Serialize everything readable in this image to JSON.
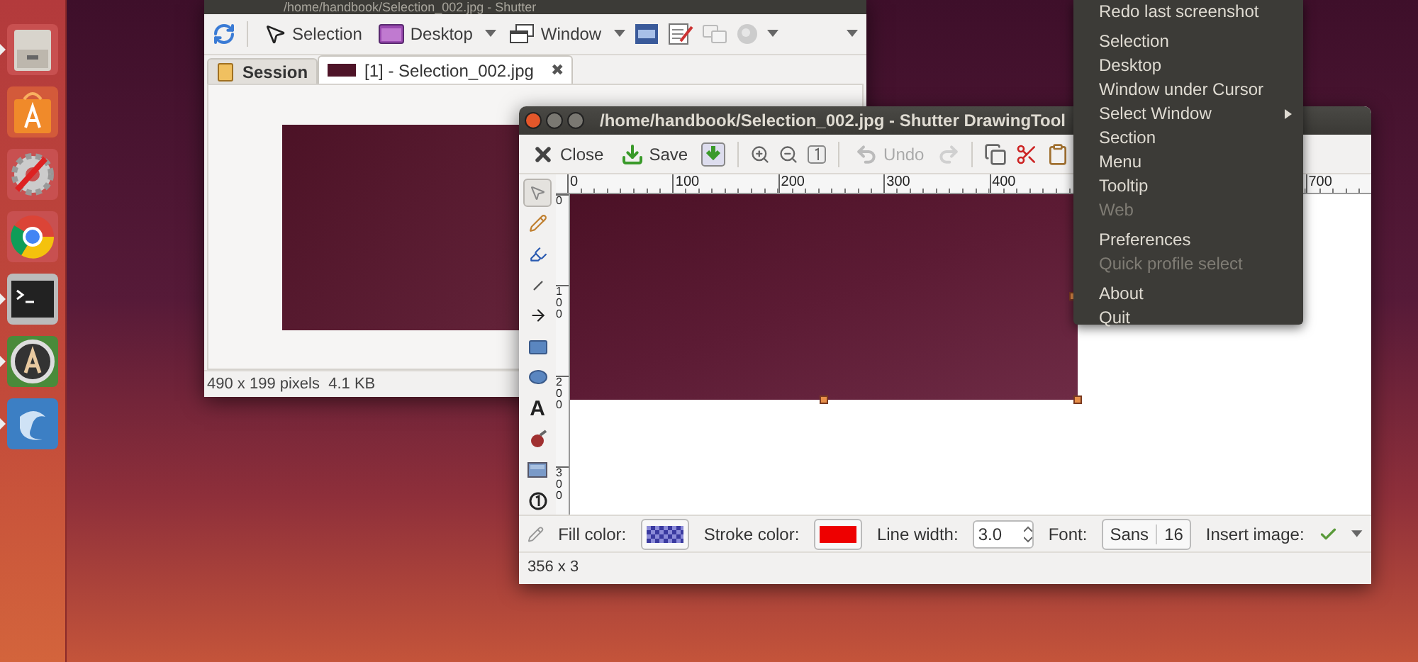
{
  "launcher": [
    {
      "kind": "files",
      "running": true
    },
    {
      "kind": "software",
      "running": false
    },
    {
      "kind": "settings",
      "running": false
    },
    {
      "kind": "browser",
      "running": false
    },
    {
      "kind": "terminal",
      "running": true
    },
    {
      "kind": "updater",
      "running": true
    },
    {
      "kind": "shutter",
      "running": true
    }
  ],
  "main_window": {
    "title": "/home/handbook/Selection_002.jpg - Shutter",
    "toolbar": [
      {
        "kind": "refresh"
      },
      {
        "kind": "sep"
      },
      {
        "kind": "selection",
        "label": "Selection"
      },
      {
        "kind": "desktop",
        "label": "Desktop",
        "dropdown": true
      },
      {
        "kind": "window",
        "label": "Window",
        "dropdown": true
      },
      {
        "kind": "menu"
      },
      {
        "kind": "tooltip"
      },
      {
        "kind": "web"
      },
      {
        "kind": "globe",
        "dropdown": true
      }
    ],
    "tabs": [
      {
        "label": "Session",
        "kind": "session",
        "selected": false
      },
      {
        "label": "[1] - Selection_002.jpg",
        "kind": "file",
        "selected": true
      }
    ],
    "close_tab": "✖",
    "status": "490 x 199 pixels  4.1 KB"
  },
  "drawing_window": {
    "title": "/home/handbook/Selection_002.jpg - Shutter DrawingTool",
    "toolbar": [
      {
        "kind": "close",
        "label": "Close",
        "disabled": false
      },
      {
        "kind": "save",
        "label": "Save",
        "disabled": false
      },
      {
        "kind": "saveas",
        "disabled": false
      },
      {
        "kind": "sep"
      },
      {
        "kind": "zoomin",
        "disabled": false
      },
      {
        "kind": "zoomout",
        "disabled": false
      },
      {
        "kind": "zoomfit",
        "disabled": false
      },
      {
        "kind": "sep"
      },
      {
        "kind": "undo",
        "label": "Undo",
        "disabled": true
      },
      {
        "kind": "redo",
        "disabled": true
      },
      {
        "kind": "sep"
      },
      {
        "kind": "copy",
        "disabled": false
      },
      {
        "kind": "cut",
        "disabled": false
      },
      {
        "kind": "paste",
        "disabled": false
      }
    ],
    "ruler_x": [
      {
        "kind": "mark",
        "label": "0"
      },
      {
        "kind": "mark",
        "label": "100"
      },
      {
        "kind": "mark",
        "label": "200"
      },
      {
        "kind": "mark",
        "label": "300"
      },
      {
        "kind": "mark",
        "label": "400"
      },
      {
        "kind": "gap"
      },
      {
        "kind": "gap"
      },
      {
        "kind": "mark",
        "label": "700"
      }
    ],
    "ruler_y": [
      {
        "label": "0"
      },
      {
        "label": "100"
      },
      {
        "label": "200"
      },
      {
        "label": "300"
      }
    ],
    "tools": [
      {
        "kind": "pointer",
        "selected": true
      },
      {
        "kind": "pencil",
        "selected": false
      },
      {
        "kind": "highlighter",
        "selected": false
      },
      {
        "kind": "line",
        "selected": false
      },
      {
        "kind": "arrow",
        "selected": false
      },
      {
        "kind": "rectangle",
        "selected": false
      },
      {
        "kind": "ellipse",
        "selected": false
      },
      {
        "kind": "text",
        "glyph": "A",
        "selected": false
      },
      {
        "kind": "censor",
        "selected": false
      },
      {
        "kind": "pixelize",
        "selected": false
      },
      {
        "kind": "number",
        "selected": false
      }
    ],
    "fill_color": {
      "label": "Fill color:"
    },
    "stroke_color": {
      "label": "Stroke color:",
      "color": "#ee0000"
    },
    "line_width": {
      "label": "Line width:",
      "value": "3.0"
    },
    "font": {
      "label": "Font:",
      "family": "Sans",
      "size": "16"
    },
    "insert_image": {
      "label": "Insert image:"
    },
    "status": "356 x 3"
  },
  "tray_menu": [
    {
      "kind": "item",
      "label": "Redo last screenshot",
      "disabled": false
    },
    {
      "kind": "sep"
    },
    {
      "kind": "item",
      "label": "Selection",
      "disabled": false
    },
    {
      "kind": "item",
      "label": "Desktop",
      "disabled": false
    },
    {
      "kind": "item",
      "label": "Window under Cursor",
      "disabled": false
    },
    {
      "kind": "submenu",
      "label": "Select Window",
      "disabled": false
    },
    {
      "kind": "item",
      "label": "Section",
      "disabled": false
    },
    {
      "kind": "item",
      "label": "Menu",
      "disabled": false
    },
    {
      "kind": "item",
      "label": "Tooltip",
      "disabled": false
    },
    {
      "kind": "item",
      "label": "Web",
      "disabled": true
    },
    {
      "kind": "sep"
    },
    {
      "kind": "item",
      "label": "Preferences",
      "disabled": false
    },
    {
      "kind": "item",
      "label": "Quick profile select",
      "disabled": true
    },
    {
      "kind": "sep"
    },
    {
      "kind": "item",
      "label": "About",
      "disabled": false
    },
    {
      "kind": "item",
      "label": "Quit",
      "disabled": false
    }
  ]
}
